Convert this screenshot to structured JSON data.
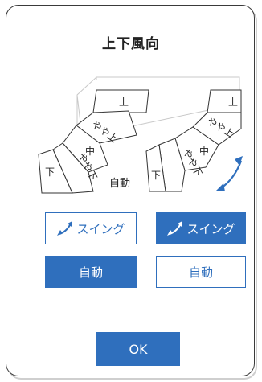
{
  "dialog": {
    "title": "上下風向",
    "ok_label": "OK"
  },
  "diagram": {
    "left_fan": {
      "top": "上",
      "slightly_up": "やや上",
      "middle": "中",
      "slightly_down": "やや下",
      "bottom": "下",
      "auto_label": "自動"
    },
    "right_fan": {
      "top": "上",
      "slightly_up": "やや上",
      "middle": "中",
      "slightly_down": "やや下",
      "bottom": "下"
    }
  },
  "buttons": {
    "swing_left": "スイング",
    "swing_right": "スイング",
    "auto_left": "自動",
    "auto_right": "自動"
  },
  "colors": {
    "accent": "#2f6fbd",
    "text": "#222222"
  }
}
